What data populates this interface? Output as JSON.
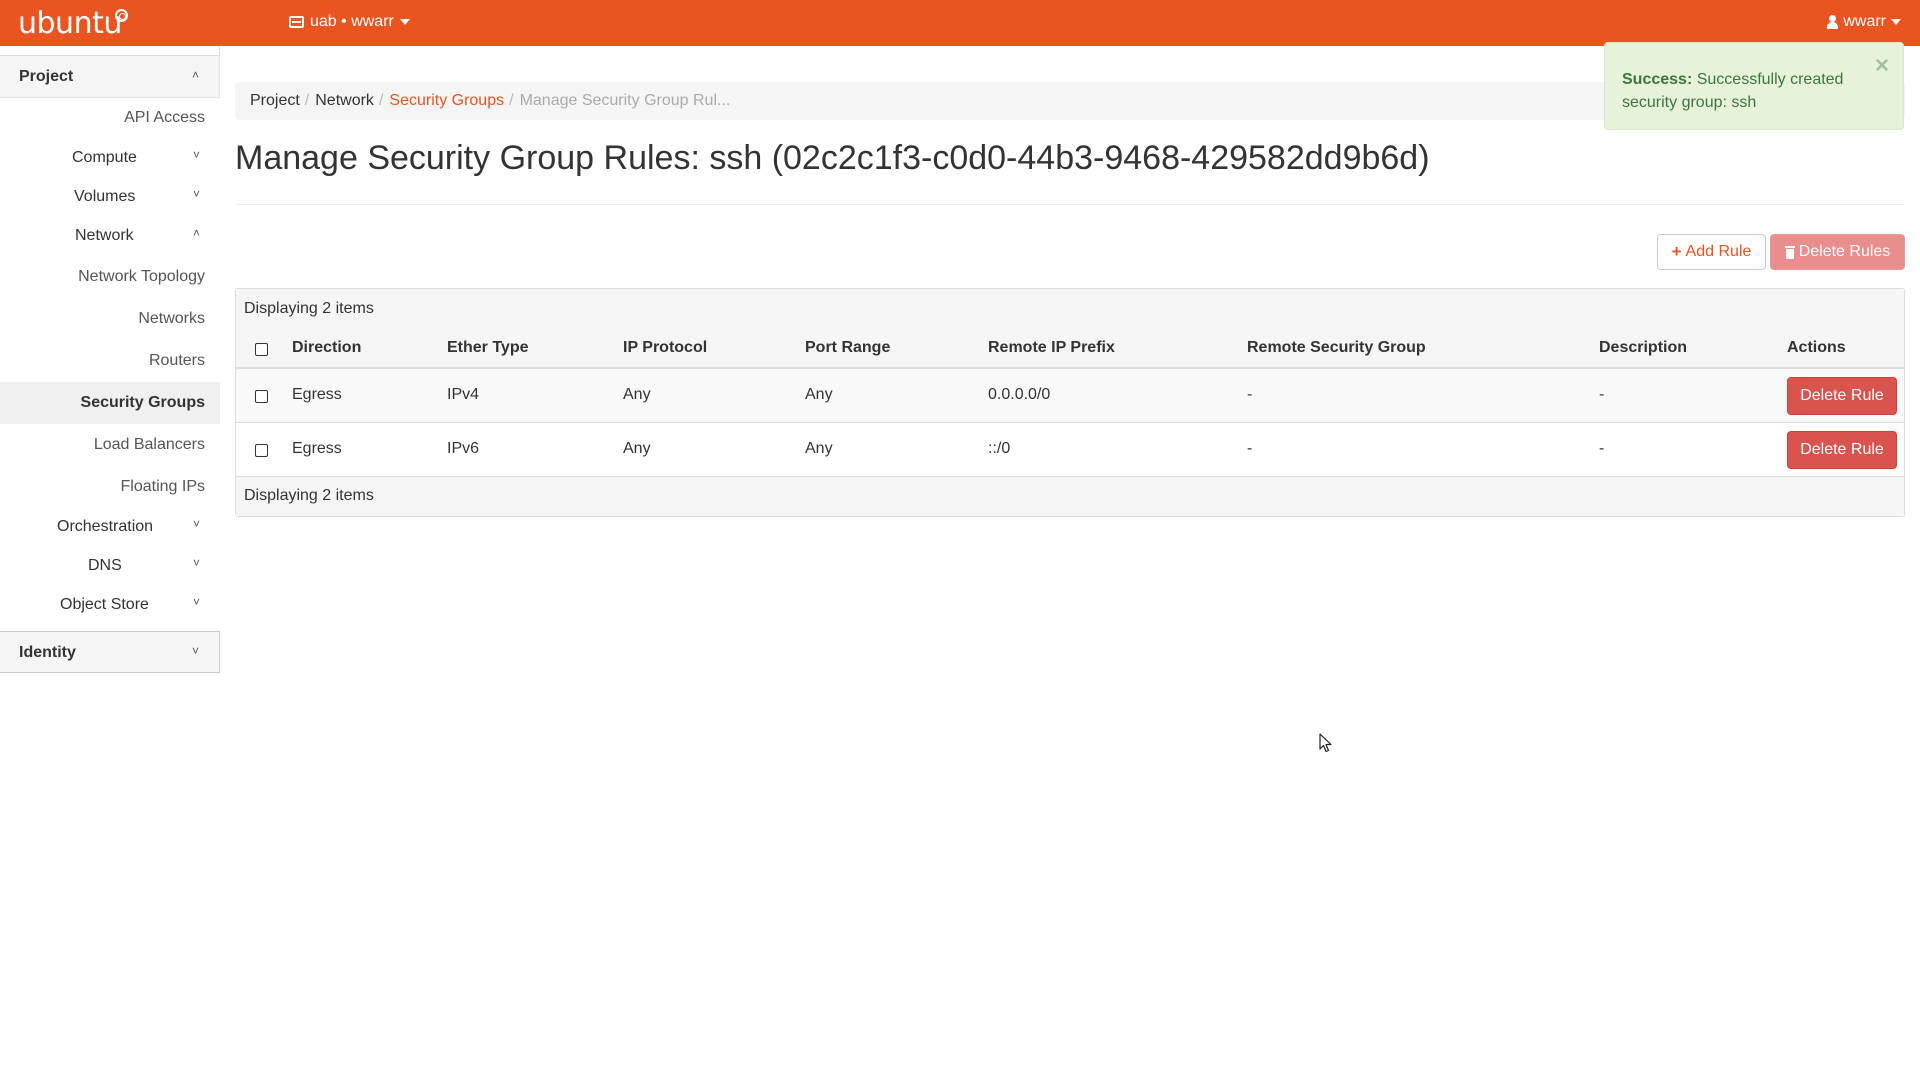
{
  "topbar": {
    "logo_text": "ubuntu",
    "project_switcher": "uab • wwarr",
    "user_menu": "wwarr",
    "brand_color": "#e95420"
  },
  "sidebar": {
    "project_label": "Project",
    "project_chevron": "˄",
    "items": {
      "api_access": "API Access",
      "compute": "Compute",
      "volumes": "Volumes",
      "network": "Network",
      "orchestration": "Orchestration",
      "dns": "DNS",
      "object_store": "Object Store"
    },
    "network_children": {
      "network_topology": "Network Topology",
      "networks": "Networks",
      "routers": "Routers",
      "security_groups": "Security Groups",
      "load_balancers": "Load Balancers",
      "floating_ips": "Floating IPs"
    },
    "active_item": "Security Groups",
    "identity_label": "Identity",
    "chevron_down": "˅",
    "chevron_up": "˄"
  },
  "breadcrumb": {
    "items": [
      "Project",
      "Network"
    ],
    "link": "Security Groups",
    "current": "Manage Security Group Rul...",
    "separator": "/"
  },
  "page": {
    "title": "Manage Security Group Rules: ssh (02c2c1f3-c0d0-44b3-9468-429582dd9b6d)"
  },
  "toolbar": {
    "add_rule_label": "Add Rule",
    "delete_rules_label": "Delete Rules"
  },
  "table": {
    "caption": "Displaying 2 items",
    "footer": "Displaying 2 items",
    "columns": [
      "Direction",
      "Ether Type",
      "IP Protocol",
      "Port Range",
      "Remote IP Prefix",
      "Remote Security Group",
      "Description",
      "Actions"
    ],
    "rows": [
      {
        "direction": "Egress",
        "ether_type": "IPv4",
        "ip_protocol": "Any",
        "port_range": "Any",
        "remote_ip_prefix": "0.0.0.0/0",
        "remote_security_group": "-",
        "description": "-",
        "action": "Delete Rule"
      },
      {
        "direction": "Egress",
        "ether_type": "IPv6",
        "ip_protocol": "Any",
        "port_range": "Any",
        "remote_ip_prefix": "::/0",
        "remote_security_group": "-",
        "description": "-",
        "action": "Delete Rule"
      }
    ]
  },
  "alert": {
    "title": "Success:",
    "message": "Successfully created security group: ssh",
    "close": "×"
  }
}
